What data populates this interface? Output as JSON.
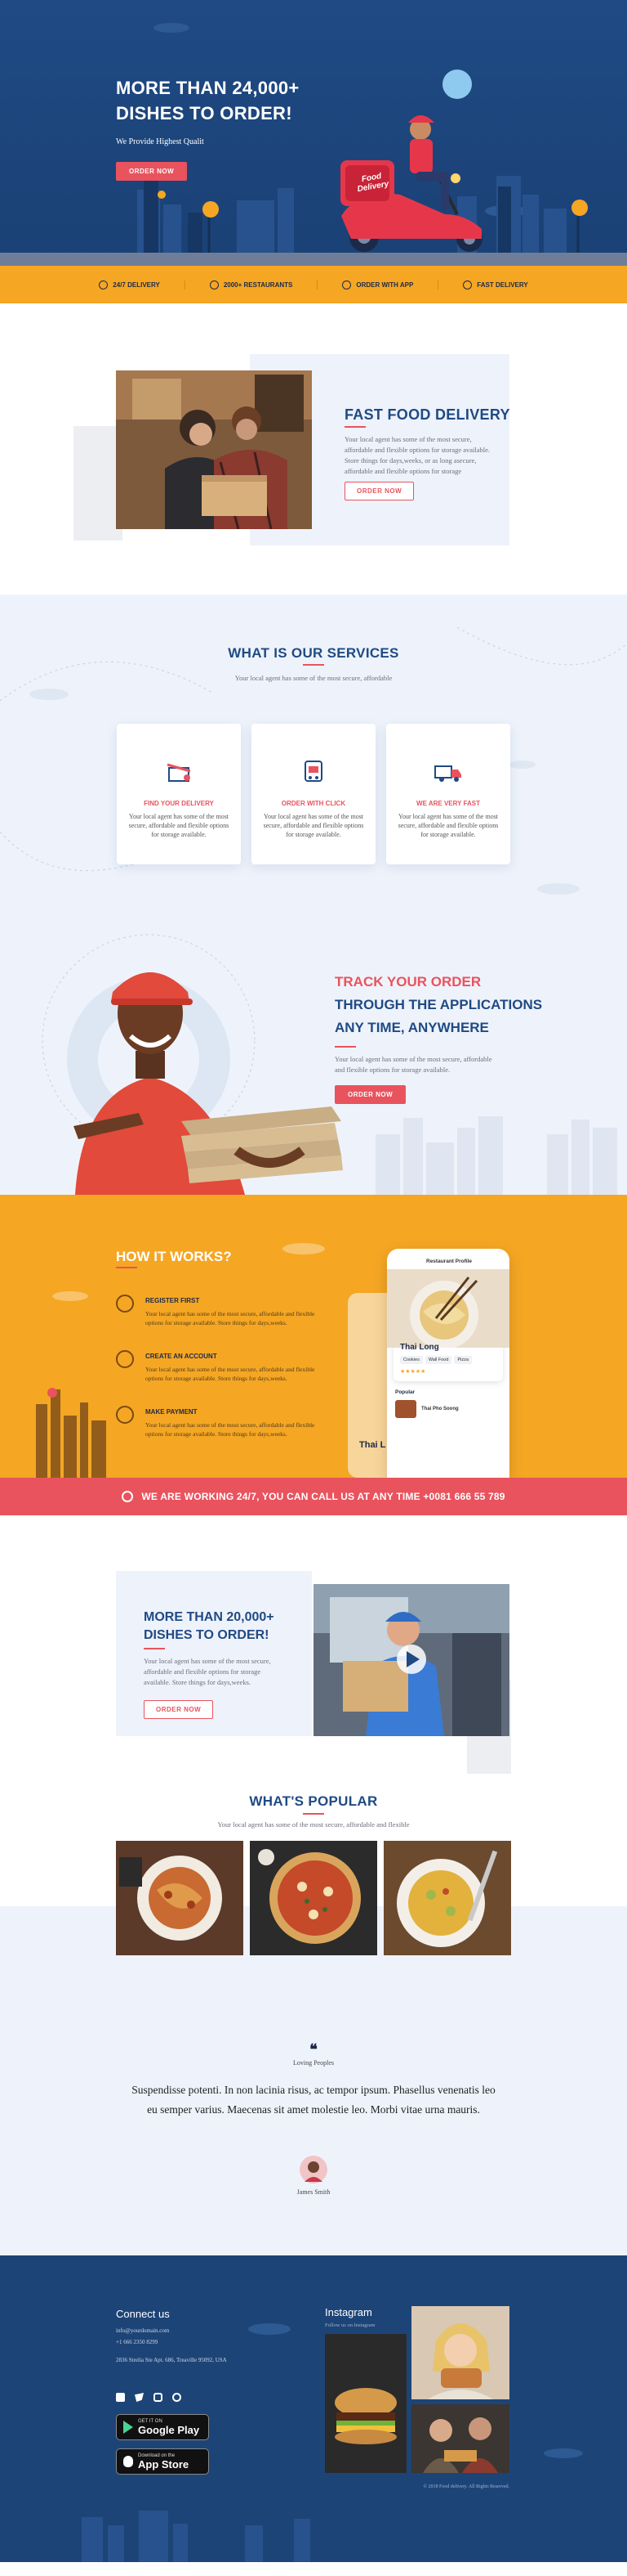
{
  "hero": {
    "title_line1": "MORE THAN 24,000+",
    "title_line2": "DISHES TO ORDER!",
    "tagline": "We Provide Highest Qualit",
    "cta": "ORDER NOW",
    "scooter_text": "Food Delivery"
  },
  "features": [
    {
      "icon": "clock-icon",
      "label": "24/7 DELIVERY"
    },
    {
      "icon": "store-icon",
      "label": "2000+ RESTAURANTS"
    },
    {
      "icon": "phone-icon",
      "label": "ORDER WITH APP"
    },
    {
      "icon": "truck-icon",
      "label": "FAST DELIVERY"
    }
  ],
  "fastfood": {
    "title": "FAST FOOD DELIVERY",
    "body": "Your local agent has some of the most secure, affordable and flexible options for storage available. Store things for days,weeks, or as long asecure, affordable and flexible options for storage",
    "cta": "ORDER NOW"
  },
  "services": {
    "title": "WHAT IS OUR SERVICES",
    "subtitle": "Your local agent has some of the most secure, affordable",
    "cards": [
      {
        "icon": "gift-icon",
        "title": "FIND YOUR DELIVERY",
        "body": "Your local agent has some of the most secure, affordable and flexible options for storage available."
      },
      {
        "icon": "cart-icon",
        "title": "ORDER WITH CLICK",
        "body": "Your local agent has some of the most secure, affordable and flexible options for storage available."
      },
      {
        "icon": "truck-icon",
        "title": "WE ARE VERY FAST",
        "body": "Your local agent has some of the most secure, affordable and flexible options for storage available."
      }
    ]
  },
  "track": {
    "line1": "TRACK YOUR ORDER",
    "line2": "THROUGH THE APPLICATIONS",
    "line3": "ANY TIME, ANYWHERE",
    "body": "Your local agent has some of the most secure, affordable and flexible options for storage available.",
    "cta": "ORDER NOW"
  },
  "how": {
    "title": "HOW IT WORKS?",
    "steps": [
      {
        "title": "REGISTER FIRST",
        "body": "Your local agent has some of the most secure, affordable and flexible options for storage available. Store things for days,weeks."
      },
      {
        "title": "CREATE AN ACCOUNT",
        "body": "Your local agent has some of the most secure, affordable and flexible options for storage available. Store things for days,weeks."
      },
      {
        "title": "MAKE PAYMENT",
        "body": "Your local agent has some of the most secure, affordable and flexible options for storage available. Store things for days,weeks."
      }
    ],
    "phone": {
      "header": "Restaurant Profile",
      "restaurant": "Thai Long",
      "tags": [
        "Cookies",
        "Wall Food",
        "Pizza"
      ],
      "popular": "Popular",
      "item_name": "Thai Pho Soong",
      "back_name": "Thai L"
    }
  },
  "call": {
    "text": "WE ARE WORKING 24/7, YOU CAN CALL US AT ANY TIME ",
    "phone": "+0081 666 55 789"
  },
  "more": {
    "title_line1": "MORE THAN 20,000+",
    "title_line2": "DISHES TO ORDER!",
    "body": "Your local agent has some of the most secure, affordable and flexible options for storage available. Store things for days,weeks.",
    "cta": "ORDER NOW"
  },
  "popular": {
    "title": "WHAT'S POPULAR",
    "subtitle": "Your local agent has some of the most secure, affordable and flexible"
  },
  "testimonial": {
    "label": "Loving Peoples",
    "quote": "Suspendisse potenti. In non lacinia risus, ac tempor ipsum. Phasellus venenatis leo eu semper varius. Maecenas sit amet molestie leo. Morbi vitae urna mauris.",
    "author": "James Smith"
  },
  "footer": {
    "connect_title": "Connect us",
    "email": "info@yourdomain.com",
    "phone": "+1 666 2350 8299",
    "address": "2836 Strelia Ste Apt. 686, Treaville 95092, USA",
    "instagram_title": "Instagram",
    "instagram_sub": "Follow us on Instagram",
    "google_small": "GET IT ON",
    "google_big": "Google Play",
    "apple_small": "Download on the",
    "apple_big": "App Store",
    "copyright": "© 2018 Food delivery. All Rights Reserved."
  },
  "colors": {
    "navy": "#1f4a84",
    "orange": "#f5a623",
    "red": "#e9535e"
  }
}
